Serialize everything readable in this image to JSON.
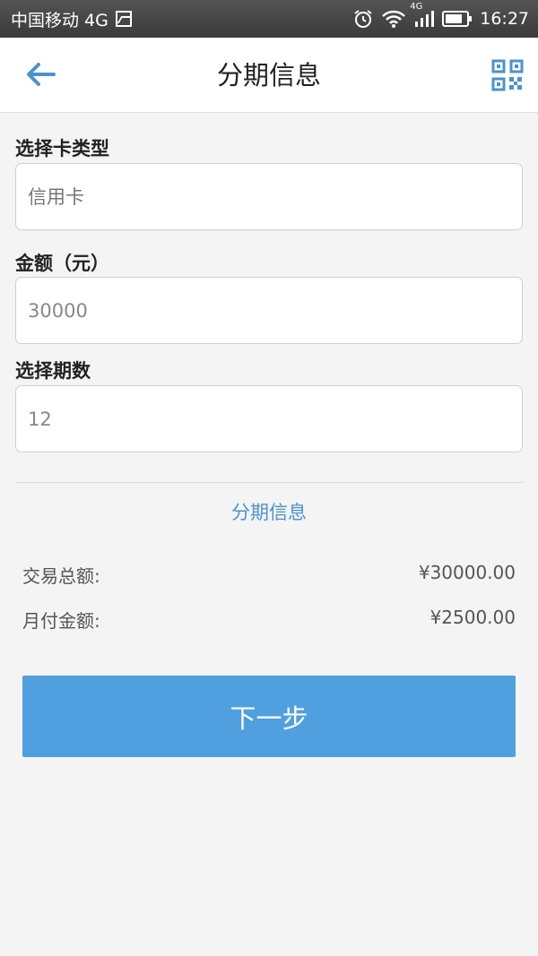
{
  "status_bar": {
    "carrier": "中国移动 4G",
    "network_small": "4G",
    "time": "16:27"
  },
  "header": {
    "title": "分期信息",
    "accent_color": "#4a93cf"
  },
  "form": {
    "card_type": {
      "label": "选择卡类型",
      "placeholder": "信用卡"
    },
    "amount": {
      "label": "金额（元）",
      "value": "30000"
    },
    "periods": {
      "label": "选择期数",
      "value": "12"
    }
  },
  "summary": {
    "title": "分期信息",
    "rows": [
      {
        "label": "交易总额:",
        "value": "¥30000.00"
      },
      {
        "label": "月付金额:",
        "value": "¥2500.00"
      }
    ]
  },
  "actions": {
    "next_label": "下一步",
    "button_color": "#509fdf"
  }
}
